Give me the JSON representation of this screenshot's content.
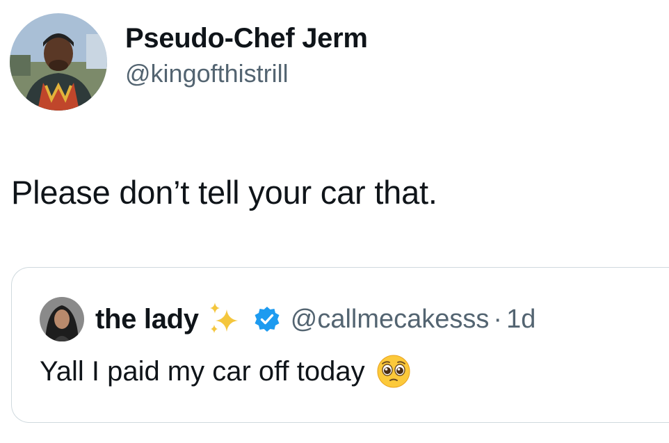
{
  "tweet": {
    "author": {
      "display_name": "Pseudo-Chef Jerm",
      "handle": "@kingofthistrill",
      "avatar_icon": "profile-photo"
    },
    "text": "Please don’t tell your car that."
  },
  "quoted_tweet": {
    "author": {
      "display_name": "the lady",
      "handle": "@callmecakesss",
      "avatar_icon": "profile-photo",
      "name_emoji": "sparkles-icon",
      "verified": true
    },
    "separator": "·",
    "time": "1d",
    "text": "Yall I paid my car off today",
    "text_emoji": "pleading-face-icon"
  },
  "colors": {
    "text_primary": "#0f1419",
    "text_secondary": "#536471",
    "border": "#cfd9de",
    "verified_blue": "#1d9bf0"
  }
}
